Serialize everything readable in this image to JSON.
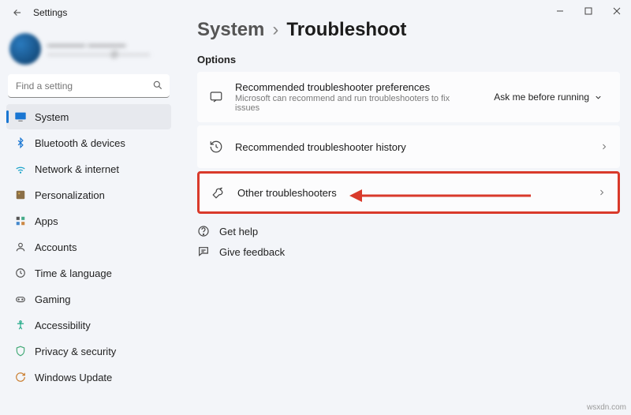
{
  "window": {
    "title": "Settings"
  },
  "profile": {
    "name": "———— ————",
    "email": "————————@————"
  },
  "search": {
    "placeholder": "Find a setting"
  },
  "sidebar": {
    "items": [
      {
        "label": "System"
      },
      {
        "label": "Bluetooth & devices"
      },
      {
        "label": "Network & internet"
      },
      {
        "label": "Personalization"
      },
      {
        "label": "Apps"
      },
      {
        "label": "Accounts"
      },
      {
        "label": "Time & language"
      },
      {
        "label": "Gaming"
      },
      {
        "label": "Accessibility"
      },
      {
        "label": "Privacy & security"
      },
      {
        "label": "Windows Update"
      }
    ]
  },
  "breadcrumb": {
    "parent": "System",
    "current": "Troubleshoot"
  },
  "section": "Options",
  "cards": {
    "pref": {
      "title": "Recommended troubleshooter preferences",
      "sub": "Microsoft can recommend and run troubleshooters to fix issues",
      "dropdown": "Ask me before running"
    },
    "history": {
      "title": "Recommended troubleshooter history"
    },
    "other": {
      "title": "Other troubleshooters"
    }
  },
  "links": {
    "help": "Get help",
    "feedback": "Give feedback"
  },
  "watermark": "wsxdn.com"
}
